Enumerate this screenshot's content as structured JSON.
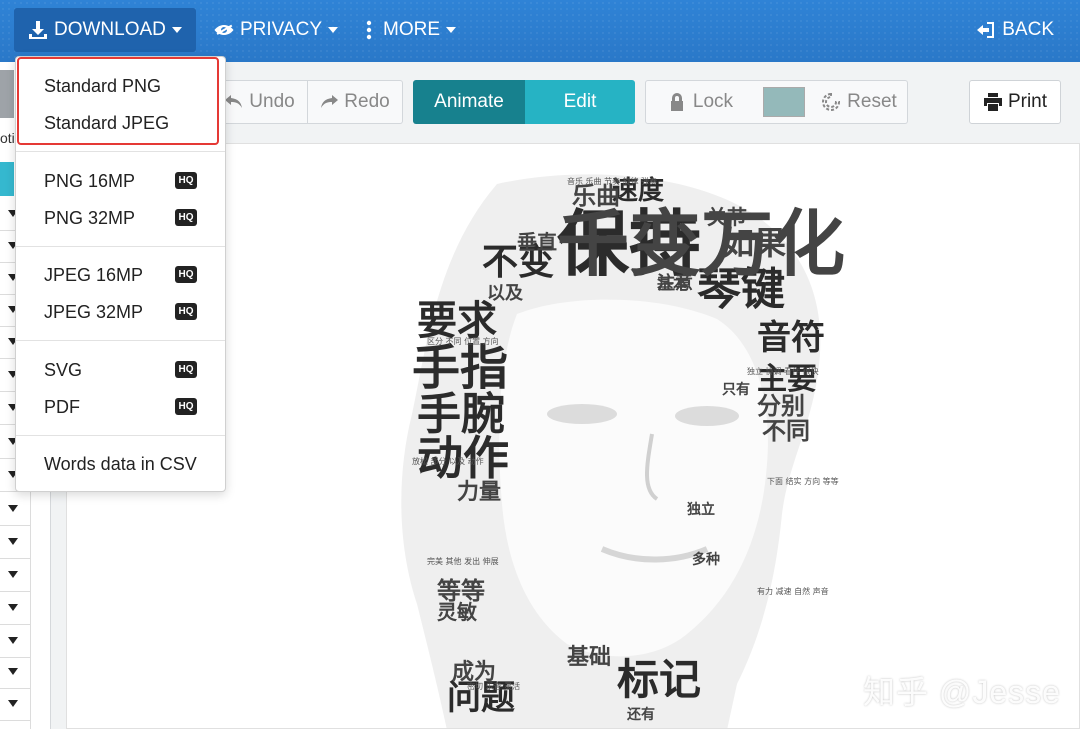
{
  "navbar": {
    "download_label": "DOWNLOAD",
    "privacy_label": "PRIVACY",
    "more_label": "MORE",
    "back_label": "BACK",
    "bg_color": "#2a7fd4"
  },
  "left_panel": {
    "partial_label": "otic"
  },
  "toolbar": {
    "undo_label": "Undo",
    "redo_label": "Redo",
    "animate_label": "Animate",
    "edit_label": "Edit",
    "lock_label": "Lock",
    "color_swatch": "#94b9ba",
    "reset_label": "Reset",
    "print_label": "Print"
  },
  "download_menu": {
    "standard_png": "Standard PNG",
    "standard_jpeg": "Standard JPEG",
    "png_16mp": "PNG 16MP",
    "png_32mp": "PNG 32MP",
    "jpeg_16mp": "JPEG 16MP",
    "jpeg_32mp": "JPEG 32MP",
    "svg": "SVG",
    "pdf": "PDF",
    "words_csv": "Words data in CSV",
    "hq_badge": "HQ",
    "highlight_color": "#e53935"
  },
  "word_cloud": {
    "words": [
      "保持",
      "琴键",
      "手指",
      "手腕",
      "动作",
      "要求",
      "不变",
      "音符",
      "主要",
      "标记",
      "问题",
      "速度",
      "乐曲",
      "如果",
      "分别",
      "不同",
      "基础",
      "等等",
      "灵敏",
      "力量",
      "关节",
      "垂直",
      "以及",
      "注意",
      "基本",
      "只有",
      "独立",
      "多种",
      "成为",
      "还有",
      "千变万化"
    ]
  },
  "watermark": "知乎 @Jesse"
}
